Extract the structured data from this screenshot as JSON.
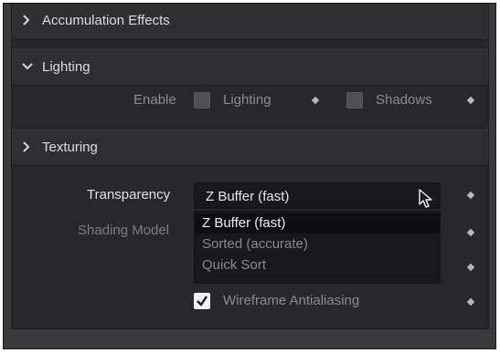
{
  "sections": {
    "accumulation": {
      "title": "Accumulation Effects",
      "chevron": "chevron-right-icon"
    },
    "lighting": {
      "title": "Lighting",
      "chevron": "chevron-down-icon"
    },
    "texturing": {
      "title": "Texturing",
      "chevron": "chevron-right-icon"
    }
  },
  "lighting": {
    "enable_label": "Enable",
    "lighting_label": "Lighting",
    "shadows_label": "Shadows",
    "lighting_checked": false,
    "shadows_checked": false
  },
  "texturing": {
    "transparency_label": "Transparency",
    "transparency_value": "Z Buffer (fast)",
    "transparency_options": [
      "Z Buffer (fast)",
      "Sorted (accurate)",
      "Quick Sort"
    ],
    "shading_model_label": "Shading Model",
    "wireframe_label": "Wireframe Antialiasing",
    "wireframe_checked": true
  },
  "icons": [
    "chevron-right-icon",
    "chevron-down-icon",
    "keyframe-diamond-icon",
    "mouse-cursor-icon",
    "checkmark-icon"
  ]
}
